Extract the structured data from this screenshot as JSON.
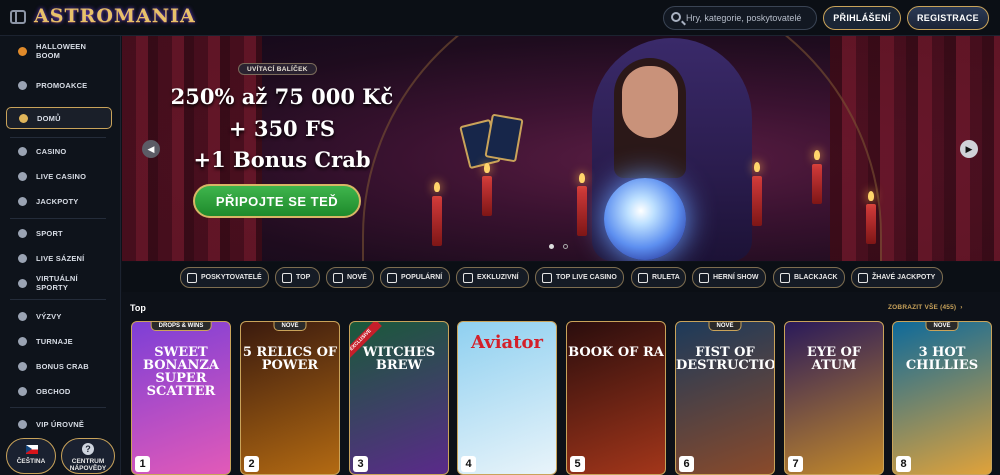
{
  "header": {
    "logo": "ASTROMANIA",
    "search_placeholder": "Hry, kategorie, poskytovatelé",
    "login_label": "PŘIHLÁŠENÍ",
    "register_label": "REGISTRACE"
  },
  "sidebar": {
    "items": [
      {
        "label": "HALLOWEEN BOOM",
        "icon": "pumpkin-icon"
      },
      {
        "label": "PROMOAKCE",
        "icon": "promo-icon"
      },
      {
        "label": "DOMŮ",
        "icon": "home-icon",
        "active": true
      },
      {
        "label": "CASINO",
        "icon": "casino-chip-icon"
      },
      {
        "label": "LIVE CASINO",
        "icon": "live-card-icon"
      },
      {
        "label": "JACKPOTY",
        "icon": "jackpot-icon"
      },
      {
        "label": "SPORT",
        "icon": "football-icon"
      },
      {
        "label": "LIVE SÁZENÍ",
        "icon": "live-betting-icon"
      },
      {
        "label": "VIRTUÁLNÍ SPORTY",
        "icon": "virtual-sports-icon"
      },
      {
        "label": "VÝZVY",
        "icon": "challenge-icon"
      },
      {
        "label": "TURNAJE",
        "icon": "trophy-icon"
      },
      {
        "label": "BONUS CRAB",
        "icon": "crab-icon"
      },
      {
        "label": "OBCHOD",
        "icon": "shop-icon"
      },
      {
        "label": "VIP ÚROVNĚ",
        "icon": "vip-icon"
      }
    ],
    "language_label": "ČEŠTINA",
    "help_label_1": "CENTRUM",
    "help_label_2": "NÁPOVĚDY"
  },
  "hero": {
    "badge": "UVÍTACÍ BALÍČEK",
    "line1": "250% až 75 000 Kč",
    "line2": "+ 350 FS",
    "line3": "+1 Bonus Crab",
    "cta": "PŘIPOJTE SE TEĎ",
    "slides_total": 2,
    "slide_active": 1
  },
  "categories": [
    {
      "label": "POSKYTOVATELÉ",
      "icon": "providers-icon"
    },
    {
      "label": "TOP",
      "icon": "trophy-icon"
    },
    {
      "label": "NOVÉ",
      "icon": "lightning-icon"
    },
    {
      "label": "POPULÁRNÍ",
      "icon": "fire-icon"
    },
    {
      "label": "EXKLUZIVNÍ",
      "icon": "diamond-icon"
    },
    {
      "label": "TOP LIVE CASINO",
      "icon": "crown-icon"
    },
    {
      "label": "RULETA",
      "icon": "roulette-icon"
    },
    {
      "label": "HERNÍ SHOW",
      "icon": "game-show-icon"
    },
    {
      "label": "BLACKJACK",
      "icon": "cards-icon"
    },
    {
      "label": "ŽHAVÉ JACKPOTY",
      "icon": "hot-jackpot-icon"
    }
  ],
  "games_section": {
    "title": "Top",
    "view_all": "ZOBRAZIT VŠE (455)",
    "games": [
      {
        "rank": "1",
        "title": "SWEET BONANZA SUPER SCATTER",
        "tag": "DROPS & WINS",
        "bg1": "#7d3fd6",
        "bg2": "#e25ab8"
      },
      {
        "rank": "2",
        "title": "5 RELICS OF POWER",
        "tag": "NOVÉ",
        "bg1": "#3a1a0e",
        "bg2": "#b36a12"
      },
      {
        "rank": "3",
        "title": "WITCHES BREW",
        "tag": "",
        "exclusive": "EXCLUSIVE",
        "bg1": "#1a5a3a",
        "bg2": "#5a2a8a"
      },
      {
        "rank": "4",
        "title": "Aviator",
        "tag": "",
        "bg1": "#8fd0f0",
        "bg2": "#e9f4fa"
      },
      {
        "rank": "5",
        "title": "BOOK OF RA",
        "tag": "",
        "bg1": "#2a0d0d",
        "bg2": "#a3361a"
      },
      {
        "rank": "6",
        "title": "FIST OF DESTRUCTION",
        "tag": "NOVÉ",
        "bg1": "#1d3a5a",
        "bg2": "#8a4a2a"
      },
      {
        "rank": "7",
        "title": "EYE OF ATUM",
        "tag": "",
        "bg1": "#2a1a5a",
        "bg2": "#c48a2a"
      },
      {
        "rank": "8",
        "title": "3 HOT CHILLIES",
        "tag": "NOVÉ",
        "bg1": "#0e6a9a",
        "bg2": "#e0a23a"
      }
    ]
  }
}
